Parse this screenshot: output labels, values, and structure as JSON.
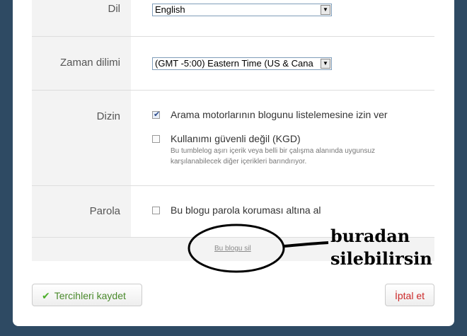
{
  "settings": {
    "language": {
      "label": "Dil",
      "value": "English"
    },
    "timezone": {
      "label": "Zaman dilimi",
      "value": "(GMT -5:00) Eastern Time (US & Cana"
    },
    "index": {
      "label": "Dizin",
      "search_engines": {
        "label": "Arama motorlarının blogunu listelemesine izin ver",
        "checked": true
      },
      "nsfw": {
        "label": "Kullanımı güvenli değil (KGD)",
        "checked": false,
        "description": "Bu tumblelog aşırı içerik veya belli bir çalışma alanında uygunsuz karşılanabilecek diğer içerikleri barındırıyor."
      }
    },
    "password": {
      "label": "Parola",
      "protect": {
        "label": "Bu blogu parola koruması altına al",
        "checked": false
      }
    },
    "delete_link": "Bu blogu sil"
  },
  "annotation": {
    "text": "buradan\nsilebilirsin"
  },
  "buttons": {
    "save": "Tercihleri kaydet",
    "cancel": "İptal et"
  },
  "colors": {
    "background": "#2e4a63",
    "save_green": "#4a8a2c",
    "cancel_red": "#cc2a2a"
  }
}
